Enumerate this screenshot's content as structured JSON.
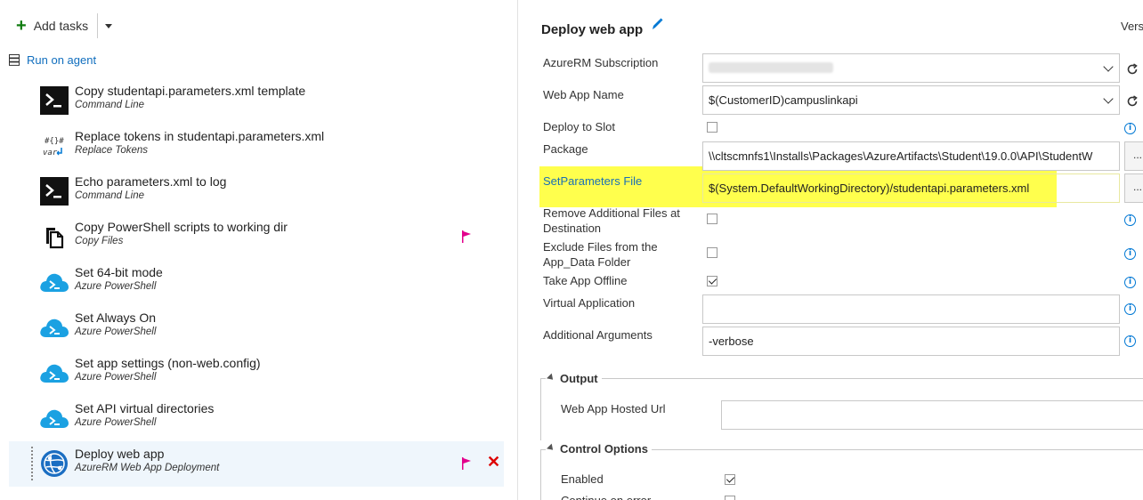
{
  "toolbar": {
    "add_tasks": "Add tasks"
  },
  "phase": {
    "label": "Run on agent"
  },
  "tasks": [
    {
      "name": "Copy studentapi.parameters.xml template",
      "kind": "Command Line",
      "icon": "command-line-icon"
    },
    {
      "name": "Replace tokens in studentapi.parameters.xml",
      "kind": "Replace Tokens",
      "icon": "replace-tokens-icon"
    },
    {
      "name": "Echo parameters.xml to log",
      "kind": "Command Line",
      "icon": "command-line-icon"
    },
    {
      "name": "Copy PowerShell scripts to working dir",
      "kind": "Copy Files",
      "icon": "copy-files-icon"
    },
    {
      "name": "Set 64-bit mode",
      "kind": "Azure PowerShell",
      "icon": "azure-powershell-icon"
    },
    {
      "name": "Set Always On",
      "kind": "Azure PowerShell",
      "icon": "azure-powershell-icon"
    },
    {
      "name": "Set app settings (non-web.config)",
      "kind": "Azure PowerShell",
      "icon": "azure-powershell-icon"
    },
    {
      "name": "Set API virtual directories",
      "kind": "Azure PowerShell",
      "icon": "azure-powershell-icon"
    },
    {
      "name": "Deploy web app",
      "kind": "AzureRM Web App Deployment",
      "icon": "azure-web-app-icon"
    }
  ],
  "detail": {
    "title": "Deploy web app",
    "version_label": "Vers",
    "fields": {
      "subscription_label": "AzureRM Subscription",
      "webapp_label": "Web App Name",
      "webapp_value": "$(CustomerID)campuslinkapi",
      "slot_label": "Deploy to Slot",
      "package_label": "Package",
      "package_value": "\\\\cltscmnfs1\\Installs\\Packages\\AzureArtifacts\\Student\\19.0.0\\API\\StudentW",
      "setparams_label": "SetParameters File",
      "setparams_value": "$(System.DefaultWorkingDirectory)/studentapi.parameters.xml",
      "remove_label": "Remove Additional Files at Destination",
      "exclude_label": "Exclude Files from the App_Data Folder",
      "offline_label": "Take App Offline",
      "virtual_label": "Virtual Application",
      "args_label": "Additional Arguments",
      "args_value": "-verbose",
      "browse_label": "..."
    },
    "output": {
      "title": "Output",
      "hosted_url_label": "Web App Hosted Url"
    },
    "control": {
      "title": "Control Options",
      "enabled_label": "Enabled",
      "continue_label": "Continue on error"
    }
  },
  "colors": {
    "highlight": "#ffff4d",
    "link": "#106ebe",
    "flag": "#e3008c",
    "delete": "#dd0000",
    "selected_row": "#eff6fc"
  }
}
